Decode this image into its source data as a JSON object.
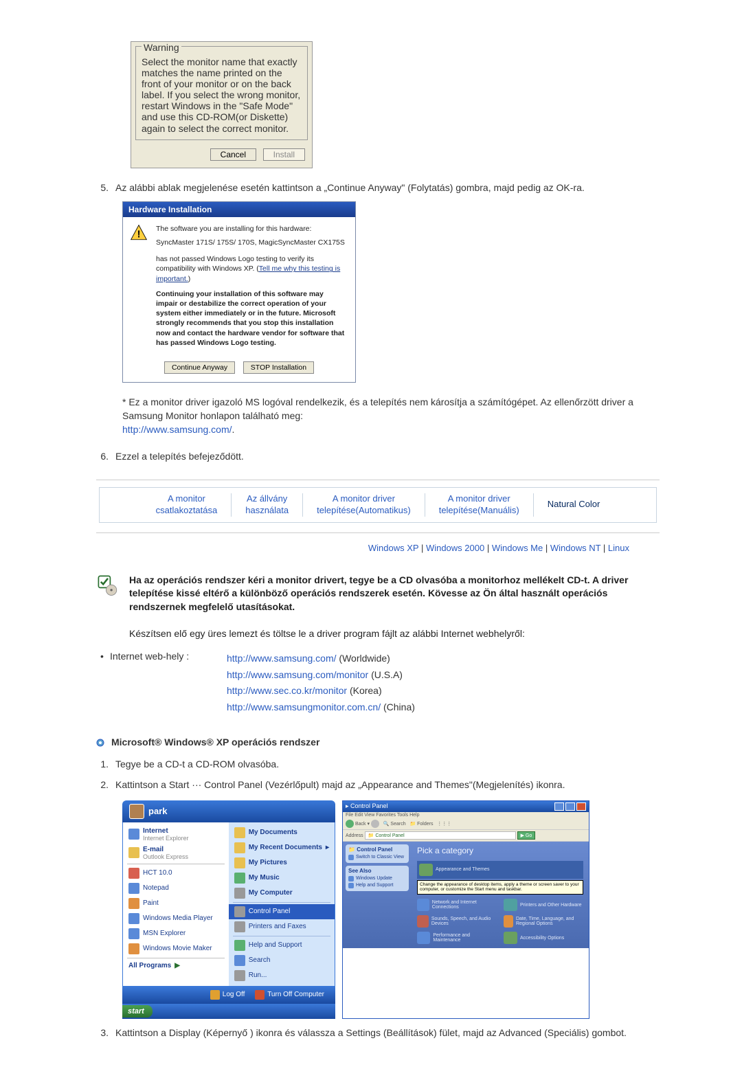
{
  "warning": {
    "legend": "Warning",
    "body": "Select the monitor name that exactly matches the name printed on the front of your monitor or on the back label. If you select the wrong monitor, restart Windows in the \"Safe Mode\" and use this CD-ROM(or Diskette) again to select the correct monitor.",
    "cancel": "Cancel",
    "install": "Install"
  },
  "step5": {
    "num": "5.",
    "text": "Az alábbi ablak megjelenése esetén kattintson a „Continue Anyway\" (Folytatás) gombra, majd pedig az OK-ra."
  },
  "hwi": {
    "title": "Hardware Installation",
    "line1": "The software you are installing for this hardware:",
    "device": "SyncMaster 171S/ 175S/ 170S, MagicSyncMaster CX175S",
    "logo1": "has not passed Windows Logo testing to verify its compatibility with Windows XP. (",
    "tell": "Tell me why this testing is important.",
    "logo2": ")",
    "bold": "Continuing your installation of this software may impair or destabilize the correct operation of your system either immediately or in the future. Microsoft strongly recommends that you stop this installation now and contact the hardware vendor for software that has passed Windows Logo testing.",
    "btn_continue": "Continue Anyway",
    "btn_stop": "STOP Installation"
  },
  "footnote": {
    "text1": "* Ez a monitor driver igazoló MS logóval rendelkezik, és a telepítés nem károsítja a számítógépet. Az ellenőrzött driver a Samsung Monitor honlapon található meg:",
    "link": "http://www.samsung.com/",
    "suffix": "."
  },
  "step6": {
    "num": "6.",
    "text": "Ezzel a telepítés befejeződött."
  },
  "tabs": {
    "t1a": "A monitor",
    "t1b": "csatlakoztatása",
    "t2a": "Az állvány",
    "t2b": "használata",
    "t3a": "A monitor driver",
    "t3b": "telepítése(Automatikus)",
    "t4a": "A monitor driver",
    "t4b": "telepítése(Manuális)",
    "t5": "Natural Color"
  },
  "oslinks": {
    "xp": "Windows XP",
    "w2000": "Windows 2000",
    "wme": "Windows Me",
    "wnt": "Windows NT",
    "linux": "Linux",
    "sep": " | "
  },
  "note": {
    "bold1": "Ha az operációs rendszer kéri a monitor drivert, tegye be a CD olvasóba a monitorhoz mellékelt CD-t. A driver telepítése kissé eltérő a különböző operációs rendszerek esetén. Kövesse az Ön által használt operációs rendszernek megfelelő utasításokat.",
    "plain": "Készítsen elő egy üres lemezt és töltse le a driver program fájlt az alábbi Internet webhelyről:"
  },
  "downloads": {
    "label": "Internet web-hely :",
    "items": [
      {
        "url": "http://www.samsung.com/",
        "suffix": " (Worldwide)"
      },
      {
        "url": "http://www.samsung.com/monitor",
        "suffix": " (U.S.A)"
      },
      {
        "url": "http://www.sec.co.kr/monitor",
        "suffix": " (Korea)"
      },
      {
        "url": "http://www.samsungmonitor.com.cn/",
        "suffix": " (China)"
      }
    ]
  },
  "os_heading": "Microsoft® Windows® XP operációs rendszer",
  "xp_steps": {
    "s1num": "1.",
    "s1": "Tegye be a CD-t a CD-ROM olvasóba.",
    "s2num": "2.",
    "s2": "Kattintson a Start ··· Control Panel (Vezérlőpult) majd az „Appearance and Themes\"(Megjelenítés) ikonra.",
    "s3num": "3.",
    "s3": "Kattintson a Display (Képernyő ) ikonra és válassza a Settings (Beállítások) fület, majd az Advanced (Speciális) gombot."
  },
  "startmenu": {
    "user": "park",
    "left": {
      "internet": "Internet",
      "internet_sub": "Internet Explorer",
      "email": "E-mail",
      "email_sub": "Outlook Express",
      "hct": "HCT 10.0",
      "notepad": "Notepad",
      "paint": "Paint",
      "wmp": "Windows Media Player",
      "msn": "MSN Explorer",
      "wmm": "Windows Movie Maker",
      "allprograms": "All Programs"
    },
    "right": {
      "mydocs": "My Documents",
      "myrecent": "My Recent Documents",
      "mypics": "My Pictures",
      "mymusic": "My Music",
      "mycomp": "My Computer",
      "cpanel": "Control Panel",
      "printers": "Printers and Faxes",
      "help": "Help and Support",
      "search": "Search",
      "run": "Run..."
    },
    "footer": {
      "logoff": "Log Off",
      "turnoff": "Turn Off Computer"
    },
    "start": "start"
  },
  "controlpanel": {
    "title": "Control Panel",
    "menu": "File   Edit   View   Favorites   Tools   Help",
    "toolbar": {
      "back": "Back",
      "search": "Search",
      "folders": "Folders"
    },
    "addr_label": "Address",
    "addr_value": "Control Panel",
    "go": "Go",
    "side1_hd": "Control Panel",
    "side1_item": "Switch to Classic View",
    "side2_hd": "See Also",
    "side2_items": [
      "Windows Update",
      "Help and Support"
    ],
    "cat_hd": "Pick a category",
    "cats": [
      {
        "label": "Appearance and Themes",
        "highlight": true,
        "tooltip": "Change the appearance of desktop items, apply a theme or screen saver to your computer, or customize the Start menu and taskbar."
      },
      {
        "label": "Printers and Other Hardware"
      },
      {
        "label": "Network and Internet Connections"
      },
      {
        "label": "Date, Time, Language, and Regional Options"
      },
      {
        "label": "Sounds, Speech, and Audio Devices"
      },
      {
        "label": "Accessibility Options"
      },
      {
        "label": "Performance and Maintenance"
      }
    ]
  }
}
